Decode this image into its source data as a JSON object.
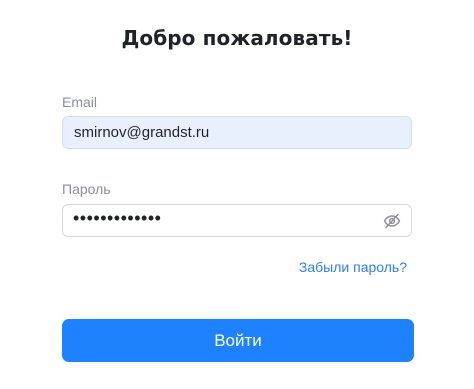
{
  "header": {
    "title": "Добро пожаловать!"
  },
  "form": {
    "email": {
      "label": "Email",
      "value": "smirnov@grandst.ru"
    },
    "password": {
      "label": "Пароль",
      "masked_value": "•••••••••••••",
      "toggle_icon": "eye-slash-icon"
    },
    "forgot_password_label": "Забыли пароль?",
    "submit_label": "Войти"
  },
  "colors": {
    "accent": "#1e82ff",
    "link": "#2e7df6",
    "email_fill": "#e8f0fe"
  }
}
